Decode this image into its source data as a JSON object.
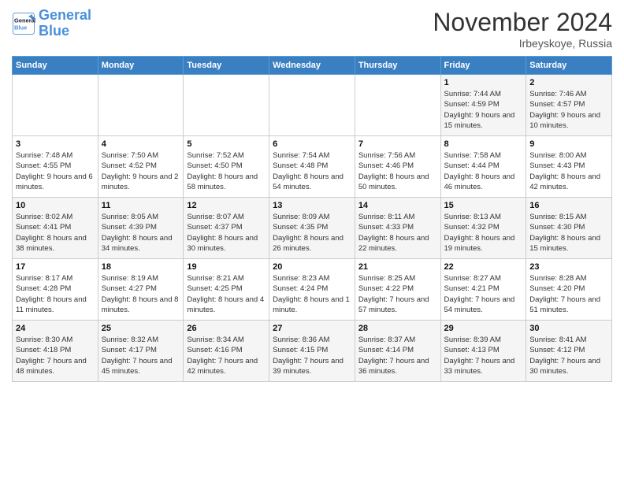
{
  "logo": {
    "line1": "General",
    "line2": "Blue"
  },
  "title": "November 2024",
  "location": "Irbeyskoye, Russia",
  "days_of_week": [
    "Sunday",
    "Monday",
    "Tuesday",
    "Wednesday",
    "Thursday",
    "Friday",
    "Saturday"
  ],
  "weeks": [
    [
      {
        "day": "",
        "info": ""
      },
      {
        "day": "",
        "info": ""
      },
      {
        "day": "",
        "info": ""
      },
      {
        "day": "",
        "info": ""
      },
      {
        "day": "",
        "info": ""
      },
      {
        "day": "1",
        "info": "Sunrise: 7:44 AM\nSunset: 4:59 PM\nDaylight: 9 hours and 15 minutes."
      },
      {
        "day": "2",
        "info": "Sunrise: 7:46 AM\nSunset: 4:57 PM\nDaylight: 9 hours and 10 minutes."
      }
    ],
    [
      {
        "day": "3",
        "info": "Sunrise: 7:48 AM\nSunset: 4:55 PM\nDaylight: 9 hours and 6 minutes."
      },
      {
        "day": "4",
        "info": "Sunrise: 7:50 AM\nSunset: 4:52 PM\nDaylight: 9 hours and 2 minutes."
      },
      {
        "day": "5",
        "info": "Sunrise: 7:52 AM\nSunset: 4:50 PM\nDaylight: 8 hours and 58 minutes."
      },
      {
        "day": "6",
        "info": "Sunrise: 7:54 AM\nSunset: 4:48 PM\nDaylight: 8 hours and 54 minutes."
      },
      {
        "day": "7",
        "info": "Sunrise: 7:56 AM\nSunset: 4:46 PM\nDaylight: 8 hours and 50 minutes."
      },
      {
        "day": "8",
        "info": "Sunrise: 7:58 AM\nSunset: 4:44 PM\nDaylight: 8 hours and 46 minutes."
      },
      {
        "day": "9",
        "info": "Sunrise: 8:00 AM\nSunset: 4:43 PM\nDaylight: 8 hours and 42 minutes."
      }
    ],
    [
      {
        "day": "10",
        "info": "Sunrise: 8:02 AM\nSunset: 4:41 PM\nDaylight: 8 hours and 38 minutes."
      },
      {
        "day": "11",
        "info": "Sunrise: 8:05 AM\nSunset: 4:39 PM\nDaylight: 8 hours and 34 minutes."
      },
      {
        "day": "12",
        "info": "Sunrise: 8:07 AM\nSunset: 4:37 PM\nDaylight: 8 hours and 30 minutes."
      },
      {
        "day": "13",
        "info": "Sunrise: 8:09 AM\nSunset: 4:35 PM\nDaylight: 8 hours and 26 minutes."
      },
      {
        "day": "14",
        "info": "Sunrise: 8:11 AM\nSunset: 4:33 PM\nDaylight: 8 hours and 22 minutes."
      },
      {
        "day": "15",
        "info": "Sunrise: 8:13 AM\nSunset: 4:32 PM\nDaylight: 8 hours and 19 minutes."
      },
      {
        "day": "16",
        "info": "Sunrise: 8:15 AM\nSunset: 4:30 PM\nDaylight: 8 hours and 15 minutes."
      }
    ],
    [
      {
        "day": "17",
        "info": "Sunrise: 8:17 AM\nSunset: 4:28 PM\nDaylight: 8 hours and 11 minutes."
      },
      {
        "day": "18",
        "info": "Sunrise: 8:19 AM\nSunset: 4:27 PM\nDaylight: 8 hours and 8 minutes."
      },
      {
        "day": "19",
        "info": "Sunrise: 8:21 AM\nSunset: 4:25 PM\nDaylight: 8 hours and 4 minutes."
      },
      {
        "day": "20",
        "info": "Sunrise: 8:23 AM\nSunset: 4:24 PM\nDaylight: 8 hours and 1 minute."
      },
      {
        "day": "21",
        "info": "Sunrise: 8:25 AM\nSunset: 4:22 PM\nDaylight: 7 hours and 57 minutes."
      },
      {
        "day": "22",
        "info": "Sunrise: 8:27 AM\nSunset: 4:21 PM\nDaylight: 7 hours and 54 minutes."
      },
      {
        "day": "23",
        "info": "Sunrise: 8:28 AM\nSunset: 4:20 PM\nDaylight: 7 hours and 51 minutes."
      }
    ],
    [
      {
        "day": "24",
        "info": "Sunrise: 8:30 AM\nSunset: 4:18 PM\nDaylight: 7 hours and 48 minutes."
      },
      {
        "day": "25",
        "info": "Sunrise: 8:32 AM\nSunset: 4:17 PM\nDaylight: 7 hours and 45 minutes."
      },
      {
        "day": "26",
        "info": "Sunrise: 8:34 AM\nSunset: 4:16 PM\nDaylight: 7 hours and 42 minutes."
      },
      {
        "day": "27",
        "info": "Sunrise: 8:36 AM\nSunset: 4:15 PM\nDaylight: 7 hours and 39 minutes."
      },
      {
        "day": "28",
        "info": "Sunrise: 8:37 AM\nSunset: 4:14 PM\nDaylight: 7 hours and 36 minutes."
      },
      {
        "day": "29",
        "info": "Sunrise: 8:39 AM\nSunset: 4:13 PM\nDaylight: 7 hours and 33 minutes."
      },
      {
        "day": "30",
        "info": "Sunrise: 8:41 AM\nSunset: 4:12 PM\nDaylight: 7 hours and 30 minutes."
      }
    ]
  ]
}
